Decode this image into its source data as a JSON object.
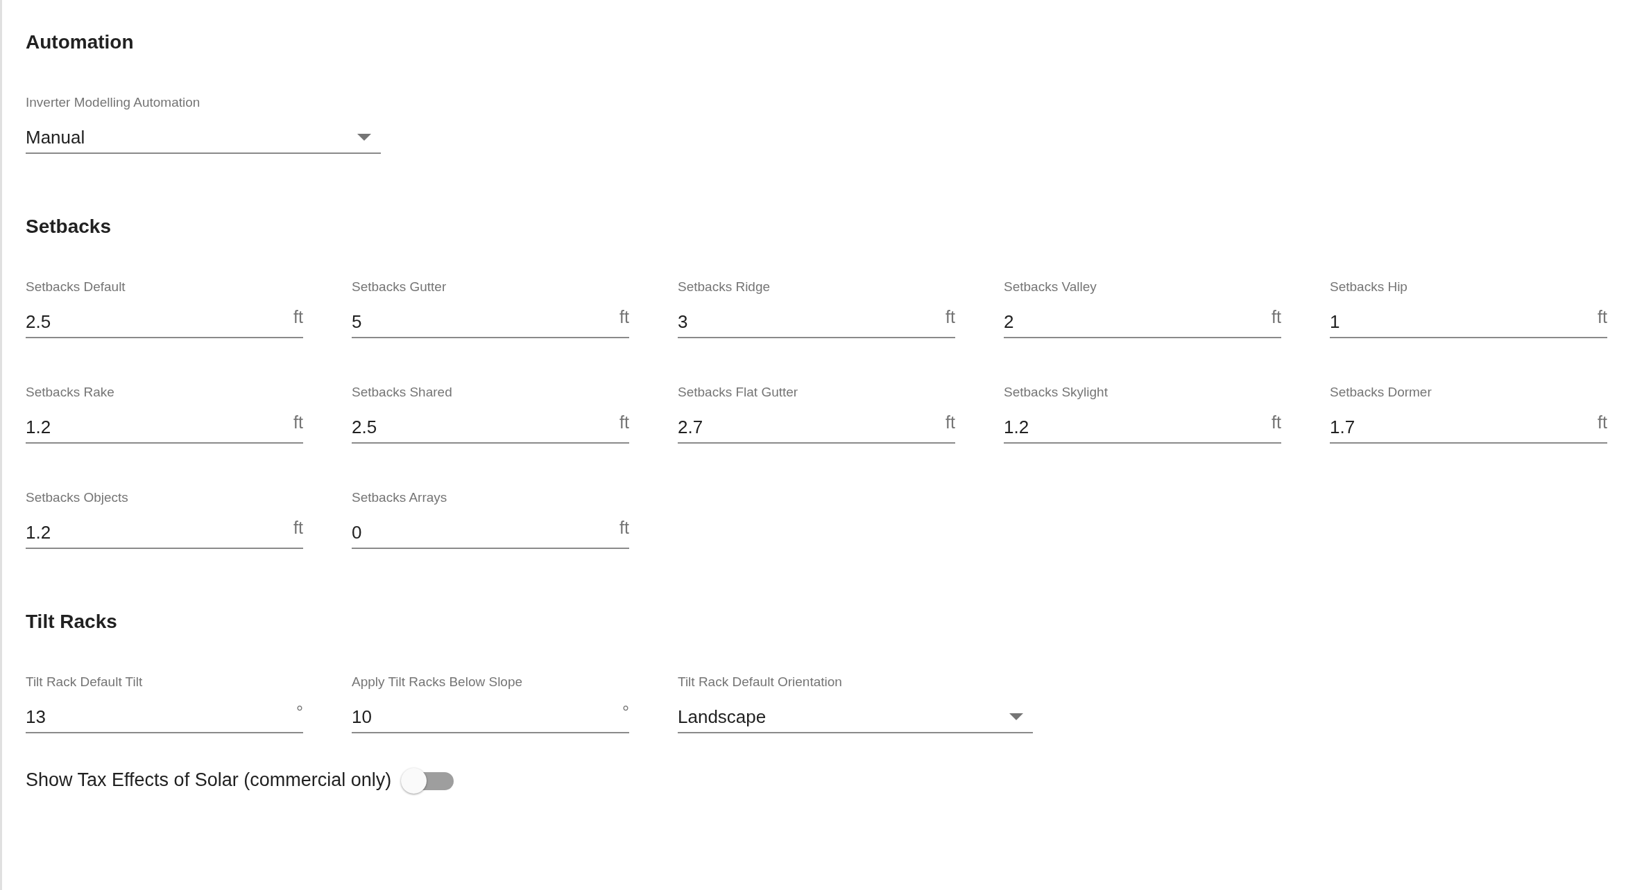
{
  "sections": [
    {
      "title": "Automation",
      "fields": [
        {
          "kind": "select",
          "label": "Inverter Modelling Automation",
          "value": "Manual"
        }
      ]
    },
    {
      "title": "Setbacks",
      "fields": [
        {
          "kind": "number",
          "label": "Setbacks Default",
          "value": "2.5",
          "unit": "ft"
        },
        {
          "kind": "number",
          "label": "Setbacks Gutter",
          "value": "5",
          "unit": "ft"
        },
        {
          "kind": "number",
          "label": "Setbacks Ridge",
          "value": "3",
          "unit": "ft"
        },
        {
          "kind": "number",
          "label": "Setbacks Valley",
          "value": "2",
          "unit": "ft"
        },
        {
          "kind": "number",
          "label": "Setbacks Hip",
          "value": "1",
          "unit": "ft"
        },
        {
          "kind": "number",
          "label": "Setbacks Rake",
          "value": "1.2",
          "unit": "ft"
        },
        {
          "kind": "number",
          "label": "Setbacks Shared",
          "value": "2.5",
          "unit": "ft"
        },
        {
          "kind": "number",
          "label": "Setbacks Flat Gutter",
          "value": "2.7",
          "unit": "ft"
        },
        {
          "kind": "number",
          "label": "Setbacks Skylight",
          "value": "1.2",
          "unit": "ft"
        },
        {
          "kind": "number",
          "label": "Setbacks Dormer",
          "value": "1.7",
          "unit": "ft"
        },
        {
          "kind": "number",
          "label": "Setbacks Objects",
          "value": "1.2",
          "unit": "ft"
        },
        {
          "kind": "number",
          "label": "Setbacks Arrays",
          "value": "0",
          "unit": "ft"
        }
      ]
    },
    {
      "title": "Tilt Racks",
      "fields": [
        {
          "kind": "number",
          "label": "Tilt Rack Default Tilt",
          "value": "13",
          "unit": "°"
        },
        {
          "kind": "number",
          "label": "Apply Tilt Racks Below Slope",
          "value": "10",
          "unit": "°"
        },
        {
          "kind": "select",
          "label": "Tilt Rack Default Orientation",
          "value": "Landscape"
        }
      ],
      "toggle": {
        "label": "Show Tax Effects of Solar (commercial only)",
        "on": false
      }
    }
  ]
}
